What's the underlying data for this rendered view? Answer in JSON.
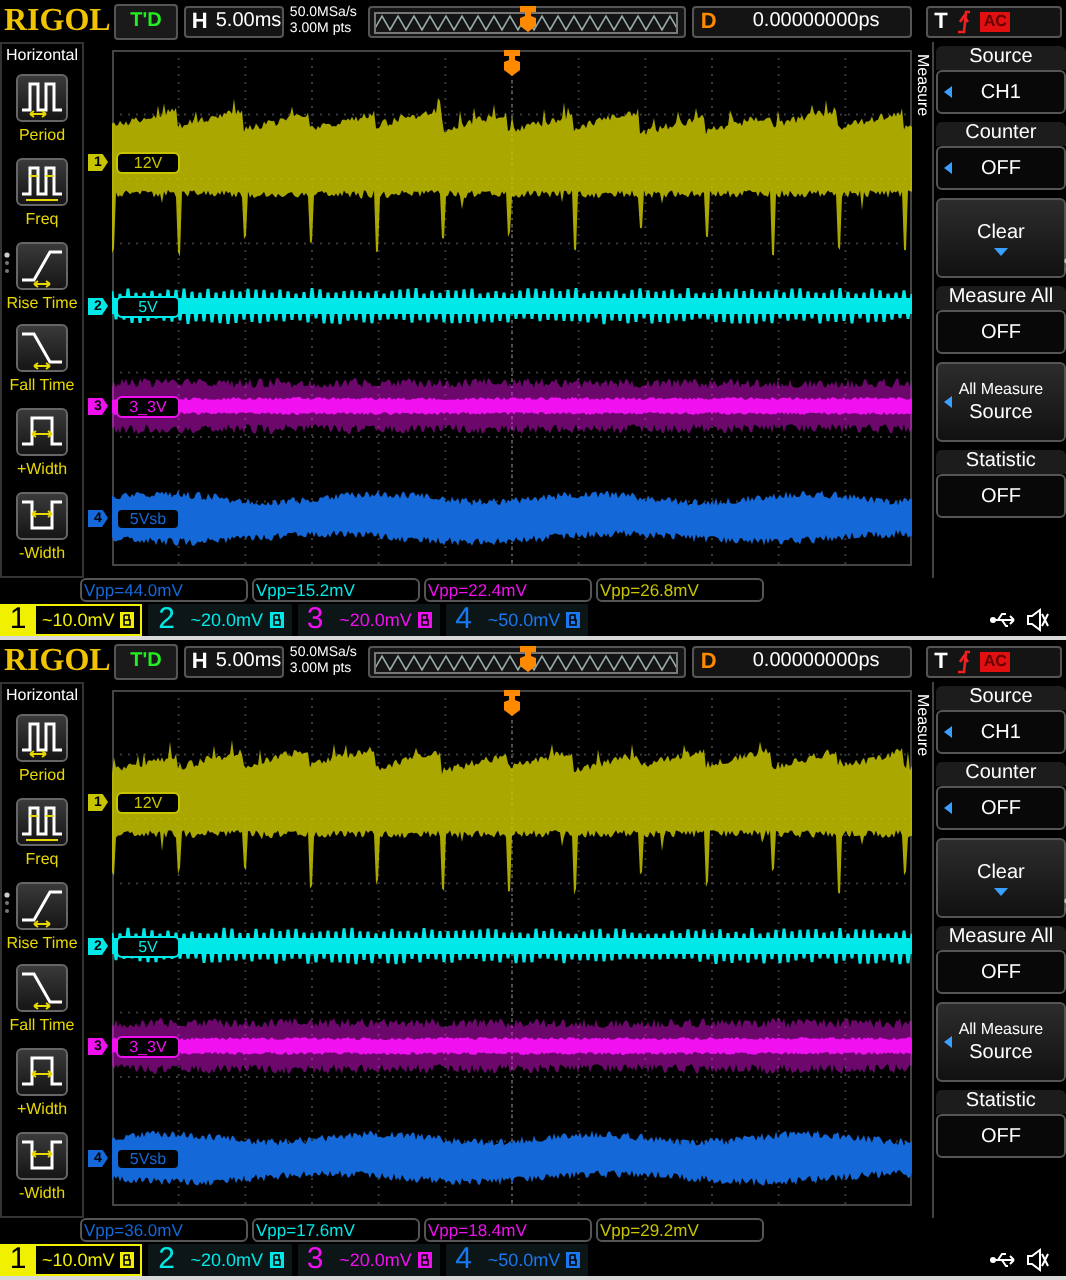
{
  "screens": [
    {
      "brand": "RIGOL",
      "run_state": "T'D",
      "timebase": {
        "label": "H",
        "value": "5.00ms"
      },
      "sample_rate": "50.0MSa/s",
      "memory_depth": "3.00M pts",
      "delay": {
        "label": "D",
        "value": "0.00000000ps"
      },
      "trigger": {
        "label": "T",
        "coupling": "AC"
      },
      "left_menu": {
        "title": "Horizontal",
        "items": [
          {
            "label": "Period",
            "kind": "period"
          },
          {
            "label": "Freq",
            "kind": "freq"
          },
          {
            "label": "Rise Time",
            "kind": "rise"
          },
          {
            "label": "Fall Time",
            "kind": "fall"
          },
          {
            "label": "+Width",
            "kind": "pwidth"
          },
          {
            "label": "-Width",
            "kind": "nwidth"
          }
        ]
      },
      "traces": [
        {
          "marker": "1",
          "label": "12V",
          "color": "#c8c400",
          "kind": "bursty"
        },
        {
          "marker": "2",
          "label": "5V",
          "color": "#00e8e8",
          "kind": "ripple"
        },
        {
          "marker": "3",
          "label": "3_3V",
          "color": "#f010f0",
          "kind": "core"
        },
        {
          "marker": "4",
          "label": "5Vsb",
          "color": "#1468d8",
          "kind": "band"
        }
      ],
      "measurements": [
        {
          "text": "Vpp=44.0mV",
          "color": "#1468d8"
        },
        {
          "text": "Vpp=15.2mV",
          "color": "#00e8e8"
        },
        {
          "text": "Vpp=22.4mV",
          "color": "#f010f0"
        },
        {
          "text": "Vpp=26.8mV",
          "color": "#c8c400"
        }
      ],
      "channels": [
        {
          "number": "1",
          "scale": "~10.0mV",
          "color": "#f0f000",
          "selected": true
        },
        {
          "number": "2",
          "scale": "~20.0mV",
          "color": "#00e8e8",
          "selected": false
        },
        {
          "number": "3",
          "scale": "~20.0mV",
          "color": "#f010f0",
          "selected": false
        },
        {
          "number": "4",
          "scale": "~50.0mV",
          "color": "#1a78f0",
          "selected": false
        }
      ],
      "side_menu": {
        "tab": "Measure",
        "items": [
          {
            "kind": "value",
            "title": "Source",
            "value": "CH1",
            "selectable": true,
            "submenu": false
          },
          {
            "kind": "value",
            "title": "Counter",
            "value": "OFF",
            "selectable": true,
            "submenu": false
          },
          {
            "kind": "action",
            "lines": [
              "Clear"
            ],
            "selectable": false,
            "submenu": true
          },
          {
            "kind": "value",
            "title": "Measure All",
            "value": "OFF",
            "selectable": false,
            "submenu": false
          },
          {
            "kind": "action",
            "lines": [
              "All Measure",
              "Source"
            ],
            "selectable": true,
            "submenu": false
          },
          {
            "kind": "value",
            "title": "Statistic",
            "value": "OFF",
            "selectable": false,
            "submenu": false
          }
        ]
      }
    },
    {
      "brand": "RIGOL",
      "run_state": "T'D",
      "timebase": {
        "label": "H",
        "value": "5.00ms"
      },
      "sample_rate": "50.0MSa/s",
      "memory_depth": "3.00M pts",
      "delay": {
        "label": "D",
        "value": "0.00000000ps"
      },
      "trigger": {
        "label": "T",
        "coupling": "AC"
      },
      "left_menu": {
        "title": "Horizontal",
        "items": [
          {
            "label": "Period",
            "kind": "period"
          },
          {
            "label": "Freq",
            "kind": "freq"
          },
          {
            "label": "Rise Time",
            "kind": "rise"
          },
          {
            "label": "Fall Time",
            "kind": "fall"
          },
          {
            "label": "+Width",
            "kind": "pwidth"
          },
          {
            "label": "-Width",
            "kind": "nwidth"
          }
        ]
      },
      "traces": [
        {
          "marker": "1",
          "label": "12V",
          "color": "#c8c400",
          "kind": "bursty"
        },
        {
          "marker": "2",
          "label": "5V",
          "color": "#00e8e8",
          "kind": "ripple"
        },
        {
          "marker": "3",
          "label": "3_3V",
          "color": "#f010f0",
          "kind": "core"
        },
        {
          "marker": "4",
          "label": "5Vsb",
          "color": "#1468d8",
          "kind": "band"
        }
      ],
      "measurements": [
        {
          "text": "Vpp=36.0mV",
          "color": "#1468d8"
        },
        {
          "text": "Vpp=17.6mV",
          "color": "#00e8e8"
        },
        {
          "text": "Vpp=18.4mV",
          "color": "#f010f0"
        },
        {
          "text": "Vpp=29.2mV",
          "color": "#c8c400"
        }
      ],
      "channels": [
        {
          "number": "1",
          "scale": "~10.0mV",
          "color": "#f0f000",
          "selected": true
        },
        {
          "number": "2",
          "scale": "~20.0mV",
          "color": "#00e8e8",
          "selected": false
        },
        {
          "number": "3",
          "scale": "~20.0mV",
          "color": "#f010f0",
          "selected": false
        },
        {
          "number": "4",
          "scale": "~50.0mV",
          "color": "#1a78f0",
          "selected": false
        }
      ],
      "side_menu": {
        "tab": "Measure",
        "items": [
          {
            "kind": "value",
            "title": "Source",
            "value": "CH1",
            "selectable": true,
            "submenu": false
          },
          {
            "kind": "value",
            "title": "Counter",
            "value": "OFF",
            "selectable": true,
            "submenu": false
          },
          {
            "kind": "action",
            "lines": [
              "Clear"
            ],
            "selectable": false,
            "submenu": true
          },
          {
            "kind": "value",
            "title": "Measure All",
            "value": "OFF",
            "selectable": false,
            "submenu": false
          },
          {
            "kind": "action",
            "lines": [
              "All Measure",
              "Source"
            ],
            "selectable": true,
            "submenu": false
          },
          {
            "kind": "value",
            "title": "Statistic",
            "value": "OFF",
            "selectable": false,
            "submenu": false
          }
        ]
      }
    }
  ]
}
